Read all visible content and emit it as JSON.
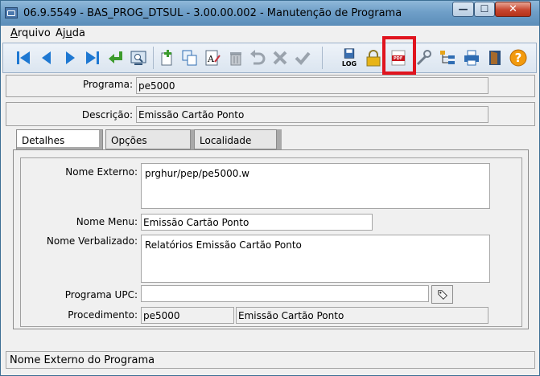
{
  "window": {
    "title": "06.9.5549 - BAS_PROG_DTSUL - 3.00.00.002 - Manutenção de Programa",
    "min_glyph": "—",
    "max_glyph": "☐",
    "close_glyph": "✕"
  },
  "menu": {
    "arquivo_first": "A",
    "arquivo_rest": "rquivo",
    "ajuda_first": "Aj",
    "ajuda_under": "u",
    "ajuda_rest": "da"
  },
  "toolbar": {
    "log_label": "LOG",
    "pdf_label": "PDF",
    "help_label": "?"
  },
  "form": {
    "programa_label": "Programa:",
    "programa_value": "pe5000",
    "descricao_label": "Descrição:",
    "descricao_value": "Emissão Cartão Ponto"
  },
  "tabs": [
    {
      "label": "Detalhes"
    },
    {
      "label": "Opções"
    },
    {
      "label": "Localidade"
    }
  ],
  "details": {
    "nome_externo_label": "Nome Externo:",
    "nome_externo_value": "prghur/pep/pe5000.w",
    "nome_menu_label": "Nome Menu:",
    "nome_menu_value": "Emissão Cartão Ponto",
    "nome_verbalizado_label": "Nome Verbalizado:",
    "nome_verbalizado_value": "Relatórios Emissão Cartão Ponto",
    "programa_upc_label": "Programa UPC:",
    "programa_upc_value": "",
    "procedimento_label": "Procedimento:",
    "procedimento_value": "pe5000",
    "procedimento_desc_value": "Emissão Cartão Ponto"
  },
  "status": {
    "text": "Nome Externo do Programa"
  },
  "colors": {
    "title_bar": "#6f9fc8",
    "highlight": "#e0141e",
    "nav_blue": "#1e78d2",
    "add_green": "#3c9b2d"
  }
}
